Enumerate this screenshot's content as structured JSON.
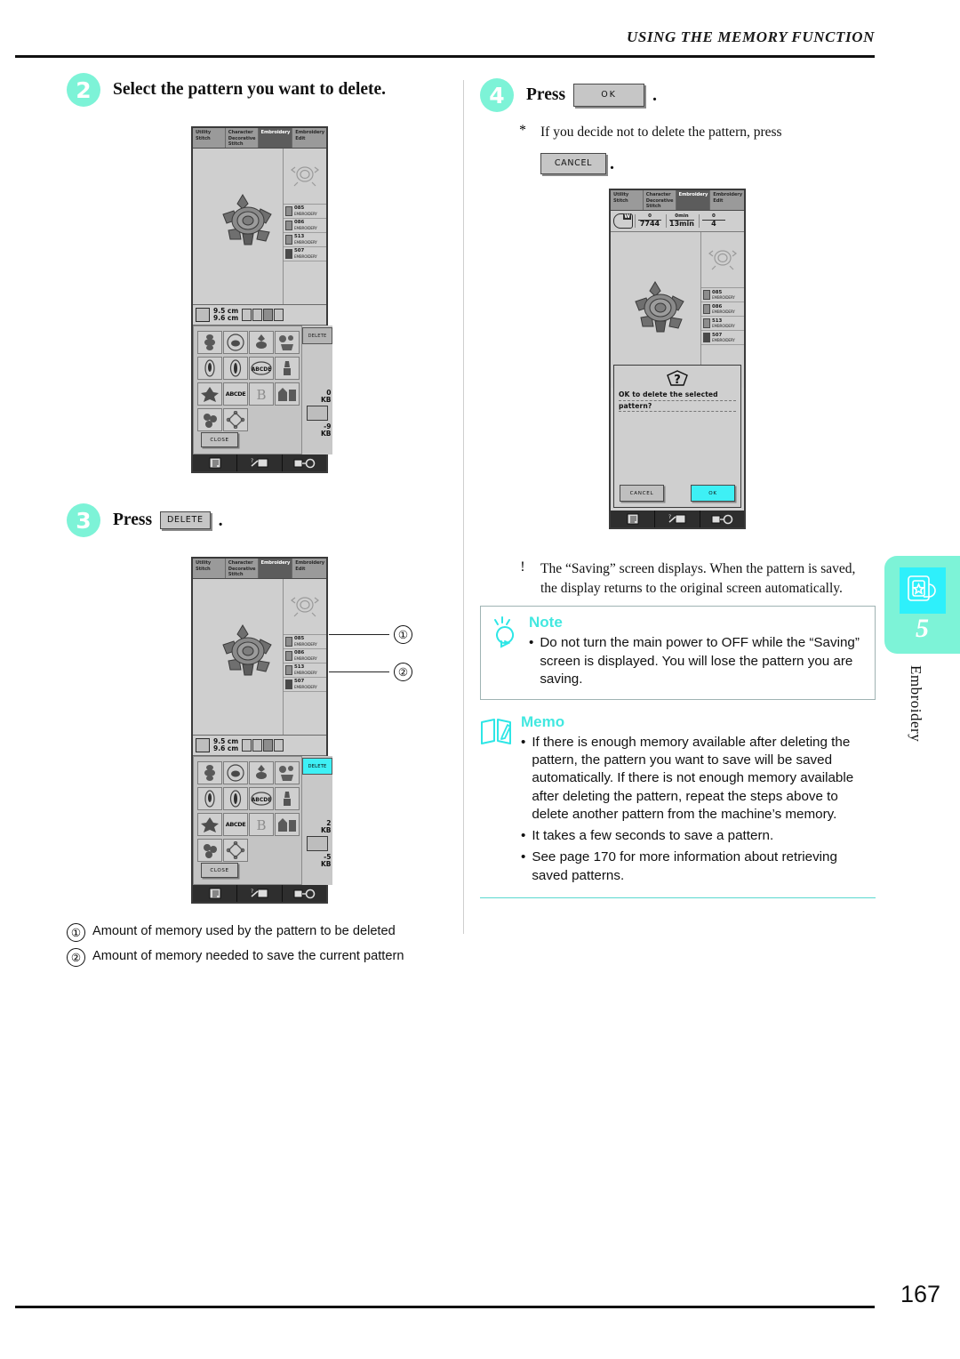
{
  "running_head": "USING THE MEMORY FUNCTION",
  "page_number": "167",
  "steps": {
    "step2": {
      "number": "2",
      "title": "Select the pattern you want to delete."
    },
    "step3": {
      "number": "3",
      "press_label": "Press",
      "key_label": "DELETE",
      "period": "."
    },
    "step4": {
      "number": "4",
      "press_label": "Press",
      "key_label": "OK",
      "period": "."
    }
  },
  "step4_note": {
    "marker": "*",
    "text_before": "If you decide not to delete the pattern, press",
    "cancel_key": "CANCEL",
    "period": "."
  },
  "saving_note": {
    "marker": "!",
    "text": "The “Saving” screen displays. When the pattern is saved, the display returns to the original screen automatically."
  },
  "callouts": {
    "one": "①",
    "two": "②",
    "caption_one": "Amount of memory used by the pattern to be deleted",
    "caption_two": "Amount of memory needed to save the current pattern"
  },
  "note_box": {
    "title": "Note",
    "icon": "lightbulb-icon",
    "bullet": "•",
    "text": "Do not turn the main power to OFF while the “Saving” screen is displayed. You will lose the pattern you are saving."
  },
  "memo_box": {
    "title": "Memo",
    "icon": "book-pencil-icon",
    "bullets": [
      "If there is enough memory available after deleting the pattern, the pattern you want to save will be saved automatically. If there is not enough memory available after deleting the pattern, repeat the steps above to delete another pattern from the machine’s memory.",
      "It takes a few seconds to save a pattern.",
      "See page 170 for more information about retrieving saved patterns."
    ],
    "bullet": "•"
  },
  "chapter_tab": {
    "number": "5",
    "label": "Embroidery",
    "bg_color": "#7df3d7",
    "icon_color": "#2ef0fb"
  },
  "lcd": {
    "tabs": [
      {
        "line1": "Utility",
        "line2": "Stitch",
        "line3": ""
      },
      {
        "line1": "Character",
        "line2": "Decorative",
        "line3": "Stitch"
      },
      {
        "line1": "Embroidery",
        "line2": "",
        "line3": ""
      },
      {
        "line1": "Embroidery",
        "line2": "Edit",
        "line3": ""
      }
    ],
    "active_tab_index": 2,
    "threads": [
      {
        "code": "085",
        "name": "EMBROIDERY"
      },
      {
        "code": "086",
        "name": "EMBROIDERY"
      },
      {
        "code": "513",
        "name": "EMBROIDERY"
      },
      {
        "code": "507",
        "name": "EMBROIDERY"
      }
    ],
    "size": {
      "width": "9.5 cm",
      "height": "9.6 cm"
    },
    "close_label": "CLOSE",
    "delete_label": "DELETE",
    "memory": {
      "screen2_used": "0",
      "screen2_unit": "KB",
      "screen2_needed": "-9",
      "screen2_needed_unit": "KB",
      "screen3_used": "2",
      "screen3_unit": "KB",
      "screen3_needed": "-5",
      "screen3_needed_unit": "KB"
    },
    "status": {
      "stitch_current": "0",
      "stitch_total": "7744",
      "time_current": "0min",
      "time_total": "13min",
      "color_current": "0",
      "color_total": "4"
    },
    "dialog": {
      "question_icon": "question-mark-icon",
      "line1": "OK to delete the selected",
      "line2": "pattern?",
      "cancel_label": "CANCEL",
      "ok_label": "OK"
    },
    "toolbar_icons": [
      "manual-icon",
      "needle-threader-icon",
      "presser-foot-icon"
    ],
    "pattern_cells": [
      "motif-border",
      "motif-circle-bird",
      "motif-oval",
      "motif-flowers",
      "motif-oval-dark",
      "motif-oval-dark2",
      "motif-abcde-oval",
      "motif-wine",
      "motif-leaves",
      "motif-abcde",
      "motif-letter-b",
      "motif-house",
      "motif-grapes",
      "motif-frame"
    ],
    "highlight_color": "#3ef0f5"
  }
}
